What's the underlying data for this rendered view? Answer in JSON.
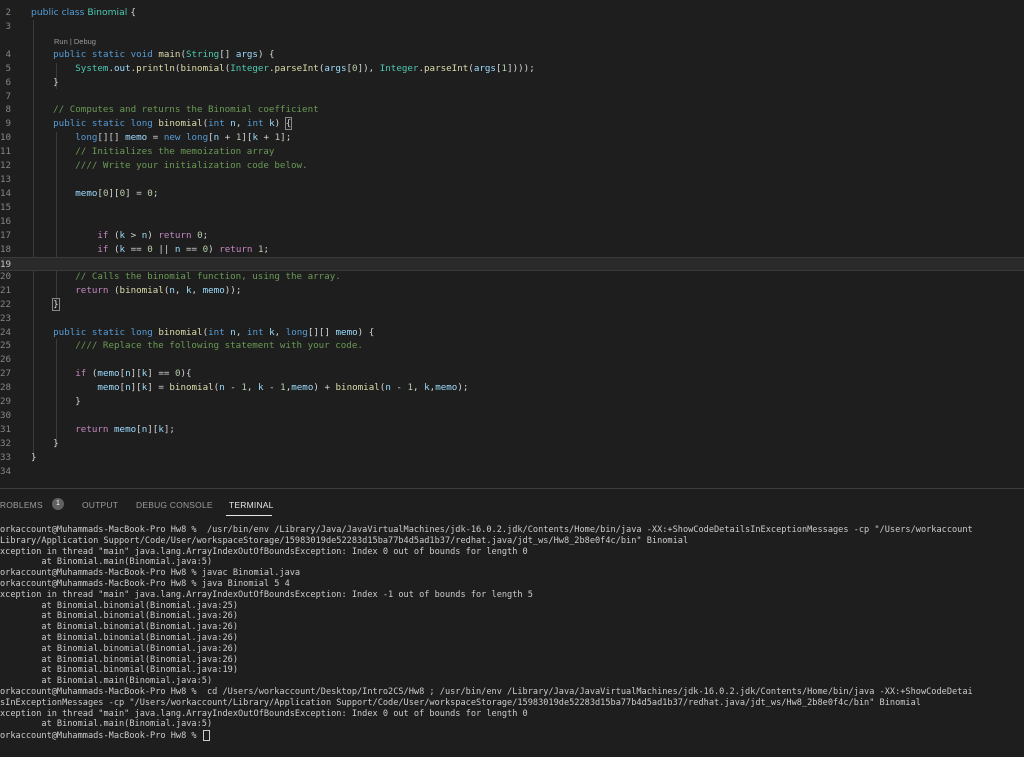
{
  "editor": {
    "code_lens": "Run | Debug",
    "lines": [
      {
        "num": "2",
        "tokens": [
          [
            "k",
            "public"
          ],
          [
            "o",
            " "
          ],
          [
            "k",
            "class"
          ],
          [
            "o",
            " "
          ],
          [
            "t",
            "Binomial"
          ],
          [
            "o",
            " {"
          ]
        ]
      },
      {
        "num": "3",
        "tokens": []
      },
      {
        "num": "4",
        "tokens": [
          [
            "o",
            "    "
          ],
          [
            "k",
            "public"
          ],
          [
            "o",
            " "
          ],
          [
            "k",
            "static"
          ],
          [
            "o",
            " "
          ],
          [
            "k",
            "void"
          ],
          [
            "o",
            " "
          ],
          [
            "f",
            "main"
          ],
          [
            "o",
            "("
          ],
          [
            "t",
            "String"
          ],
          [
            "o",
            "[] "
          ],
          [
            "v",
            "args"
          ],
          [
            "o",
            ") {"
          ]
        ]
      },
      {
        "num": "5",
        "tokens": [
          [
            "o",
            "        "
          ],
          [
            "t",
            "System"
          ],
          [
            "o",
            "."
          ],
          [
            "v",
            "out"
          ],
          [
            "o",
            "."
          ],
          [
            "f",
            "println"
          ],
          [
            "o",
            "("
          ],
          [
            "f",
            "binomial"
          ],
          [
            "o",
            "("
          ],
          [
            "t",
            "Integer"
          ],
          [
            "o",
            "."
          ],
          [
            "f",
            "parseInt"
          ],
          [
            "o",
            "("
          ],
          [
            "v",
            "args"
          ],
          [
            "o",
            "["
          ],
          [
            "n",
            "0"
          ],
          [
            "o",
            "]), "
          ],
          [
            "t",
            "Integer"
          ],
          [
            "o",
            "."
          ],
          [
            "f",
            "parseInt"
          ],
          [
            "o",
            "("
          ],
          [
            "v",
            "args"
          ],
          [
            "o",
            "["
          ],
          [
            "n",
            "1"
          ],
          [
            "o",
            "])));"
          ]
        ]
      },
      {
        "num": "6",
        "tokens": [
          [
            "o",
            "    }"
          ]
        ]
      },
      {
        "num": "7",
        "tokens": []
      },
      {
        "num": "8",
        "tokens": [
          [
            "o",
            "    "
          ],
          [
            "c",
            "// Computes and returns the Binomial coefficient"
          ]
        ]
      },
      {
        "num": "9",
        "tokens": [
          [
            "o",
            "    "
          ],
          [
            "k",
            "public"
          ],
          [
            "o",
            " "
          ],
          [
            "k",
            "static"
          ],
          [
            "o",
            " "
          ],
          [
            "k",
            "long"
          ],
          [
            "o",
            " "
          ],
          [
            "f",
            "binomial"
          ],
          [
            "o",
            "("
          ],
          [
            "k",
            "int"
          ],
          [
            "o",
            " "
          ],
          [
            "v",
            "n"
          ],
          [
            "o",
            ", "
          ],
          [
            "k",
            "int"
          ],
          [
            "o",
            " "
          ],
          [
            "v",
            "k"
          ],
          [
            "o",
            ") "
          ],
          [
            "o",
            "{"
          ]
        ]
      },
      {
        "num": "10",
        "tokens": [
          [
            "o",
            "        "
          ],
          [
            "k",
            "long"
          ],
          [
            "o",
            "[][] "
          ],
          [
            "v",
            "memo"
          ],
          [
            "o",
            " = "
          ],
          [
            "k",
            "new"
          ],
          [
            "o",
            " "
          ],
          [
            "k",
            "long"
          ],
          [
            "o",
            "["
          ],
          [
            "v",
            "n"
          ],
          [
            "o",
            " + "
          ],
          [
            "n",
            "1"
          ],
          [
            "o",
            "]["
          ],
          [
            "v",
            "k"
          ],
          [
            "o",
            " + "
          ],
          [
            "n",
            "1"
          ],
          [
            "o",
            "];"
          ]
        ]
      },
      {
        "num": "11",
        "tokens": [
          [
            "o",
            "        "
          ],
          [
            "c",
            "// Initializes the memoization array"
          ]
        ]
      },
      {
        "num": "12",
        "tokens": [
          [
            "o",
            "        "
          ],
          [
            "c",
            "//// Write your initialization code below."
          ]
        ]
      },
      {
        "num": "13",
        "tokens": []
      },
      {
        "num": "14",
        "tokens": [
          [
            "o",
            "        "
          ],
          [
            "v",
            "memo"
          ],
          [
            "o",
            "["
          ],
          [
            "n",
            "0"
          ],
          [
            "o",
            "]["
          ],
          [
            "n",
            "0"
          ],
          [
            "o",
            "] = "
          ],
          [
            "n",
            "0"
          ],
          [
            "o",
            ";"
          ]
        ]
      },
      {
        "num": "15",
        "tokens": []
      },
      {
        "num": "16",
        "tokens": []
      },
      {
        "num": "17",
        "tokens": [
          [
            "o",
            "            "
          ],
          [
            "p",
            "if"
          ],
          [
            "o",
            " ("
          ],
          [
            "v",
            "k"
          ],
          [
            "o",
            " > "
          ],
          [
            "v",
            "n"
          ],
          [
            "o",
            ") "
          ],
          [
            "p",
            "return"
          ],
          [
            "o",
            " "
          ],
          [
            "n",
            "0"
          ],
          [
            "o",
            ";"
          ]
        ]
      },
      {
        "num": "18",
        "tokens": [
          [
            "o",
            "            "
          ],
          [
            "p",
            "if"
          ],
          [
            "o",
            " ("
          ],
          [
            "v",
            "k"
          ],
          [
            "o",
            " == "
          ],
          [
            "n",
            "0"
          ],
          [
            "o",
            " || "
          ],
          [
            "v",
            "n"
          ],
          [
            "o",
            " == "
          ],
          [
            "n",
            "0"
          ],
          [
            "o",
            ") "
          ],
          [
            "p",
            "return"
          ],
          [
            "o",
            " "
          ],
          [
            "n",
            "1"
          ],
          [
            "o",
            ";"
          ]
        ]
      },
      {
        "num": "19",
        "tokens": []
      },
      {
        "num": "20",
        "tokens": [
          [
            "o",
            "        "
          ],
          [
            "c",
            "// Calls the binomial function, using the array."
          ]
        ]
      },
      {
        "num": "21",
        "tokens": [
          [
            "o",
            "        "
          ],
          [
            "p",
            "return"
          ],
          [
            "o",
            " ("
          ],
          [
            "f",
            "binomial"
          ],
          [
            "o",
            "("
          ],
          [
            "v",
            "n"
          ],
          [
            "o",
            ", "
          ],
          [
            "v",
            "k"
          ],
          [
            "o",
            ", "
          ],
          [
            "v",
            "memo"
          ],
          [
            "o",
            "));"
          ]
        ]
      },
      {
        "num": "22",
        "tokens": [
          [
            "o",
            "    "
          ],
          [
            "o",
            "}"
          ]
        ]
      },
      {
        "num": "23",
        "tokens": []
      },
      {
        "num": "24",
        "tokens": [
          [
            "o",
            "    "
          ],
          [
            "k",
            "public"
          ],
          [
            "o",
            " "
          ],
          [
            "k",
            "static"
          ],
          [
            "o",
            " "
          ],
          [
            "k",
            "long"
          ],
          [
            "o",
            " "
          ],
          [
            "f",
            "binomial"
          ],
          [
            "o",
            "("
          ],
          [
            "k",
            "int"
          ],
          [
            "o",
            " "
          ],
          [
            "v",
            "n"
          ],
          [
            "o",
            ", "
          ],
          [
            "k",
            "int"
          ],
          [
            "o",
            " "
          ],
          [
            "v",
            "k"
          ],
          [
            "o",
            ", "
          ],
          [
            "k",
            "long"
          ],
          [
            "o",
            "[][] "
          ],
          [
            "v",
            "memo"
          ],
          [
            "o",
            ") {"
          ]
        ]
      },
      {
        "num": "25",
        "tokens": [
          [
            "o",
            "        "
          ],
          [
            "c",
            "//// Replace the following statement with your code."
          ]
        ]
      },
      {
        "num": "26",
        "tokens": []
      },
      {
        "num": "27",
        "tokens": [
          [
            "o",
            "        "
          ],
          [
            "p",
            "if"
          ],
          [
            "o",
            " ("
          ],
          [
            "v",
            "memo"
          ],
          [
            "o",
            "["
          ],
          [
            "v",
            "n"
          ],
          [
            "o",
            "]["
          ],
          [
            "v",
            "k"
          ],
          [
            "o",
            "] == "
          ],
          [
            "n",
            "0"
          ],
          [
            "o",
            "){"
          ]
        ]
      },
      {
        "num": "28",
        "tokens": [
          [
            "o",
            "            "
          ],
          [
            "v",
            "memo"
          ],
          [
            "o",
            "["
          ],
          [
            "v",
            "n"
          ],
          [
            "o",
            "]["
          ],
          [
            "v",
            "k"
          ],
          [
            "o",
            "] = "
          ],
          [
            "f",
            "binomial"
          ],
          [
            "o",
            "("
          ],
          [
            "v",
            "n"
          ],
          [
            "o",
            " - "
          ],
          [
            "n",
            "1"
          ],
          [
            "o",
            ", "
          ],
          [
            "v",
            "k"
          ],
          [
            "o",
            " - "
          ],
          [
            "n",
            "1"
          ],
          [
            "o",
            ","
          ],
          [
            "v",
            "memo"
          ],
          [
            "o",
            ") + "
          ],
          [
            "f",
            "binomial"
          ],
          [
            "o",
            "("
          ],
          [
            "v",
            "n"
          ],
          [
            "o",
            " - "
          ],
          [
            "n",
            "1"
          ],
          [
            "o",
            ", "
          ],
          [
            "v",
            "k"
          ],
          [
            "o",
            ","
          ],
          [
            "v",
            "memo"
          ],
          [
            "o",
            ");"
          ]
        ]
      },
      {
        "num": "29",
        "tokens": [
          [
            "o",
            "        }"
          ]
        ]
      },
      {
        "num": "30",
        "tokens": []
      },
      {
        "num": "31",
        "tokens": [
          [
            "o",
            "        "
          ],
          [
            "p",
            "return"
          ],
          [
            "o",
            " "
          ],
          [
            "v",
            "memo"
          ],
          [
            "o",
            "["
          ],
          [
            "v",
            "n"
          ],
          [
            "o",
            "]["
          ],
          [
            "v",
            "k"
          ],
          [
            "o",
            "];"
          ]
        ]
      },
      {
        "num": "32",
        "tokens": [
          [
            "o",
            "    }"
          ]
        ]
      },
      {
        "num": "33",
        "tokens": [
          [
            "o",
            "}"
          ]
        ]
      },
      {
        "num": "34",
        "tokens": []
      }
    ],
    "active_line": "19",
    "colors": {
      "background": "#1e1e1e",
      "keyword": "#569cd6",
      "type": "#4ec9b0",
      "function": "#dcdcaa",
      "variable": "#9cdcfe",
      "number": "#b5cea8",
      "comment": "#6a9955",
      "control": "#c586c0"
    }
  },
  "panel": {
    "tabs": [
      "PROBLEMS",
      "OUTPUT",
      "DEBUG CONSOLE",
      "TERMINAL"
    ],
    "problems_count": "1",
    "active_tab": "TERMINAL",
    "terminal_lines": [
      "orkaccount@Muhammads-MacBook-Pro Hw8 %  /usr/bin/env /Library/Java/JavaVirtualMachines/jdk-16.0.2.jdk/Contents/Home/bin/java -XX:+ShowCodeDetailsInExceptionMessages -cp \"/Users/workaccount",
      "Library/Application Support/Code/User/workspaceStorage/15983019de52283d15ba77b4d5ad1b37/redhat.java/jdt_ws/Hw8_2b8e0f4c/bin\" Binomial",
      "xception in thread \"main\" java.lang.ArrayIndexOutOfBoundsException: Index 0 out of bounds for length 0",
      "        at Binomial.main(Binomial.java:5)",
      "orkaccount@Muhammads-MacBook-Pro Hw8 % javac Binomial.java",
      "orkaccount@Muhammads-MacBook-Pro Hw8 % java Binomial 5 4",
      "xception in thread \"main\" java.lang.ArrayIndexOutOfBoundsException: Index -1 out of bounds for length 5",
      "        at Binomial.binomial(Binomial.java:25)",
      "        at Binomial.binomial(Binomial.java:26)",
      "        at Binomial.binomial(Binomial.java:26)",
      "        at Binomial.binomial(Binomial.java:26)",
      "        at Binomial.binomial(Binomial.java:26)",
      "        at Binomial.binomial(Binomial.java:26)",
      "        at Binomial.binomial(Binomial.java:19)",
      "        at Binomial.main(Binomial.java:5)",
      "orkaccount@Muhammads-MacBook-Pro Hw8 %  cd /Users/workaccount/Desktop/Intro2CS/Hw8 ; /usr/bin/env /Library/Java/JavaVirtualMachines/jdk-16.0.2.jdk/Contents/Home/bin/java -XX:+ShowCodeDetai",
      "sInExceptionMessages -cp \"/Users/workaccount/Library/Application Support/Code/User/workspaceStorage/15983019de52283d15ba77b4d5ad1b37/redhat.java/jdt_ws/Hw8_2b8e0f4c/bin\" Binomial",
      "xception in thread \"main\" java.lang.ArrayIndexOutOfBoundsException: Index 0 out of bounds for length 0",
      "        at Binomial.main(Binomial.java:5)",
      "orkaccount@Muhammads-MacBook-Pro Hw8 % "
    ]
  }
}
